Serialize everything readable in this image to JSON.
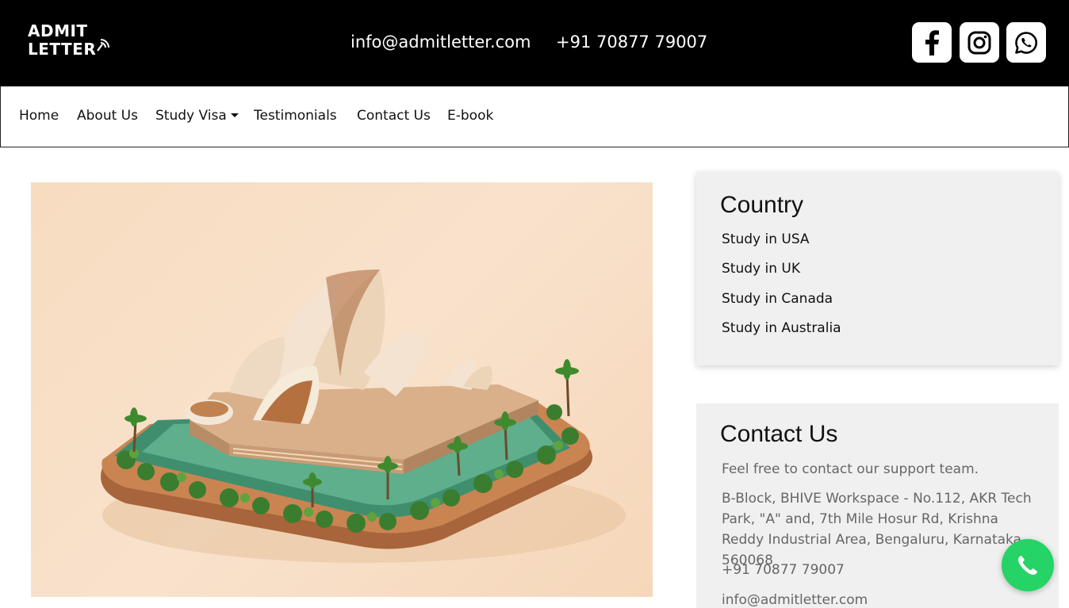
{
  "header": {
    "logo_line1": "ADMIT",
    "logo_line2": "LETTER",
    "email": "info@admitletter.com",
    "phone": "+91 70877 79007",
    "social": [
      "facebook-icon",
      "instagram-icon",
      "whatsapp-icon"
    ],
    "background": "#000000"
  },
  "nav": {
    "items": [
      {
        "label": "Home"
      },
      {
        "label": "About Us"
      },
      {
        "label": "Study Visa"
      },
      {
        "label": "Testimonials"
      },
      {
        "label": "Contact Us"
      },
      {
        "label": "E-book"
      }
    ]
  },
  "hero": {
    "image": "sydney-opera-house-miniature"
  },
  "sidebar": {
    "country": {
      "title": "Country",
      "links": [
        "Study in USA",
        "Study in UK",
        "Study in Canada",
        "Study in Australia"
      ]
    },
    "contact": {
      "title": "Contact Us",
      "intro": "Feel free to contact our support team.",
      "address": "B-Block, BHIVE Workspace - No.112, AKR Tech Park, \"A\" and, 7th Mile Hosur Rd, Krishna Reddy Industrial Area, Bengaluru, Karnataka 560068",
      "phone": "+91 70877 79007",
      "email": "info@admitletter.com"
    }
  },
  "floating": {
    "whatsapp_color": "#25d366"
  }
}
